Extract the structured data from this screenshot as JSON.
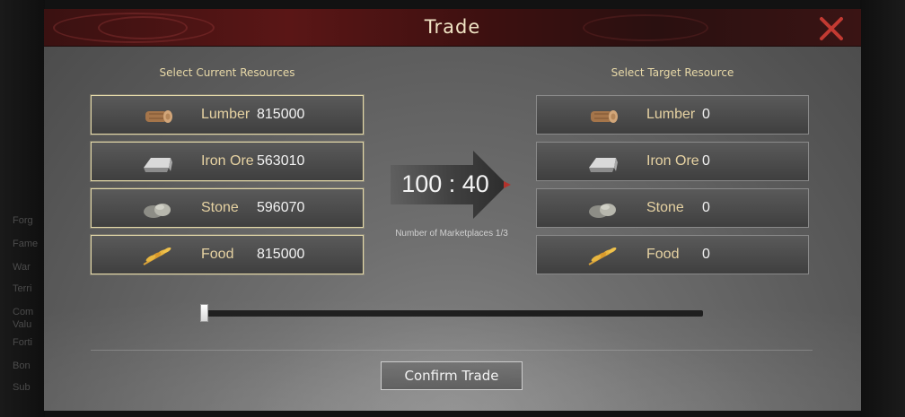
{
  "background": {
    "ghost_labels": [
      "Forg",
      "Fame",
      "War",
      "Terri",
      "Com",
      "Valu",
      "Forti",
      "Bon",
      "Sub"
    ]
  },
  "modal": {
    "title": "Trade",
    "close_icon": "close-x-icon",
    "accent_color": "#c23a32"
  },
  "current_resources": {
    "header": "Select Current Resources",
    "items": [
      {
        "name": "Lumber",
        "amount": "815000",
        "icon": "lumber-log-icon"
      },
      {
        "name": "Iron Ore",
        "amount": "563010",
        "icon": "iron-ingot-icon"
      },
      {
        "name": "Stone",
        "amount": "596070",
        "icon": "stone-icon"
      },
      {
        "name": "Food",
        "amount": "815000",
        "icon": "wheat-icon"
      }
    ]
  },
  "target_resources": {
    "header": "Select Target Resource",
    "items": [
      {
        "name": "Lumber",
        "amount": "0",
        "icon": "lumber-log-icon"
      },
      {
        "name": "Iron Ore",
        "amount": "0",
        "icon": "iron-ingot-icon"
      },
      {
        "name": "Stone",
        "amount": "0",
        "icon": "stone-icon"
      },
      {
        "name": "Food",
        "amount": "0",
        "icon": "wheat-icon"
      }
    ]
  },
  "exchange": {
    "ratio": "100 : 40",
    "marketplaces": "Number of Marketplaces 1/3"
  },
  "slider": {
    "value_fraction": 0.0
  },
  "confirm_label": "Confirm Trade"
}
